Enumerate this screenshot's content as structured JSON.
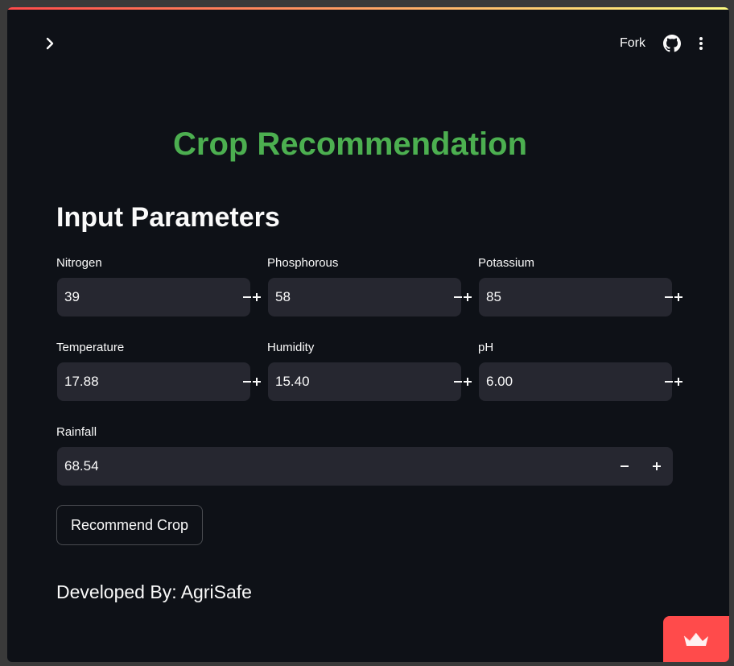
{
  "toolbar": {
    "fork_label": "Fork"
  },
  "page": {
    "title": "Crop Recommendation",
    "section_title": "Input Parameters",
    "footer": "Developed By: AgriSafe"
  },
  "fields": {
    "nitrogen": {
      "label": "Nitrogen",
      "value": "39"
    },
    "phosphorous": {
      "label": "Phosphorous",
      "value": "58"
    },
    "potassium": {
      "label": "Potassium",
      "value": "85"
    },
    "temperature": {
      "label": "Temperature",
      "value": "17.88"
    },
    "humidity": {
      "label": "Humidity",
      "value": "15.40"
    },
    "ph": {
      "label": "pH",
      "value": "6.00"
    },
    "rainfall": {
      "label": "Rainfall",
      "value": "68.54"
    }
  },
  "button": {
    "recommend_label": "Recommend Crop"
  },
  "colors": {
    "background": "#0e1117",
    "input_background": "#262730",
    "title_green": "#4caf50",
    "text": "#fafafa",
    "badge_red": "#ff4b4b"
  },
  "icons": {
    "sidebar_toggle": "chevron-right-icon",
    "github": "github-icon",
    "menu": "more-vertical-icon",
    "decrement": "minus-icon",
    "increment": "plus-icon",
    "badge": "crown-icon"
  }
}
